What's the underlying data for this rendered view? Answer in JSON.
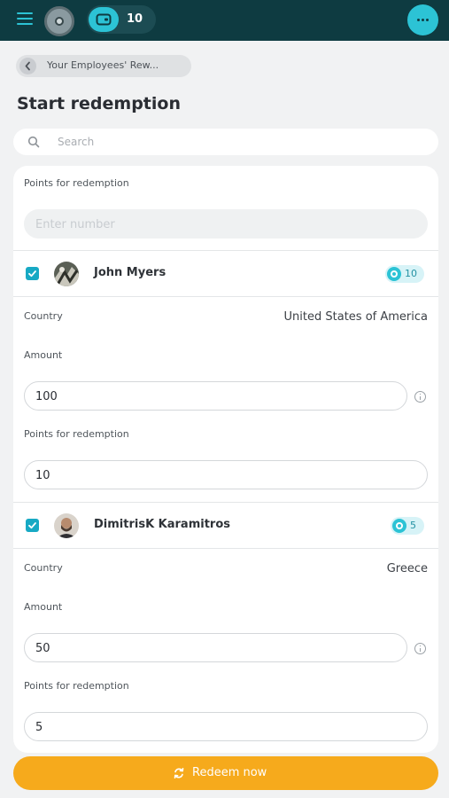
{
  "topbar": {
    "menu_icon": "hamburger-icon",
    "wallet_icon": "wallet-icon",
    "wallet_count": "10",
    "more_icon": "more-dots-icon"
  },
  "breadcrumb": {
    "label": "Your Employees' Rew..."
  },
  "page": {
    "title": "Start redemption"
  },
  "search": {
    "placeholder": "Search"
  },
  "bulk": {
    "label": "Points for redemption",
    "placeholder": "Enter number"
  },
  "employees": [
    {
      "name": "John Myers",
      "points": "10",
      "country_label": "Country",
      "country": "United States of America",
      "amount_label": "Amount",
      "amount": "100",
      "points_label": "Points for redemption",
      "points_value": "10"
    },
    {
      "name": "DimitrisK Karamitros",
      "points": "5",
      "country_label": "Country",
      "country": "Greece",
      "amount_label": "Amount",
      "amount": "50",
      "points_label": "Points for redemption",
      "points_value": "5"
    }
  ],
  "actions": {
    "redeem_label": "Redeem now",
    "redeem_icon": "refresh-icon"
  },
  "colors": {
    "topbar": "#0e3b41",
    "accent": "#2cc3d5",
    "primary_button": "#f6aa1c",
    "checkbox": "#17a9c4"
  }
}
